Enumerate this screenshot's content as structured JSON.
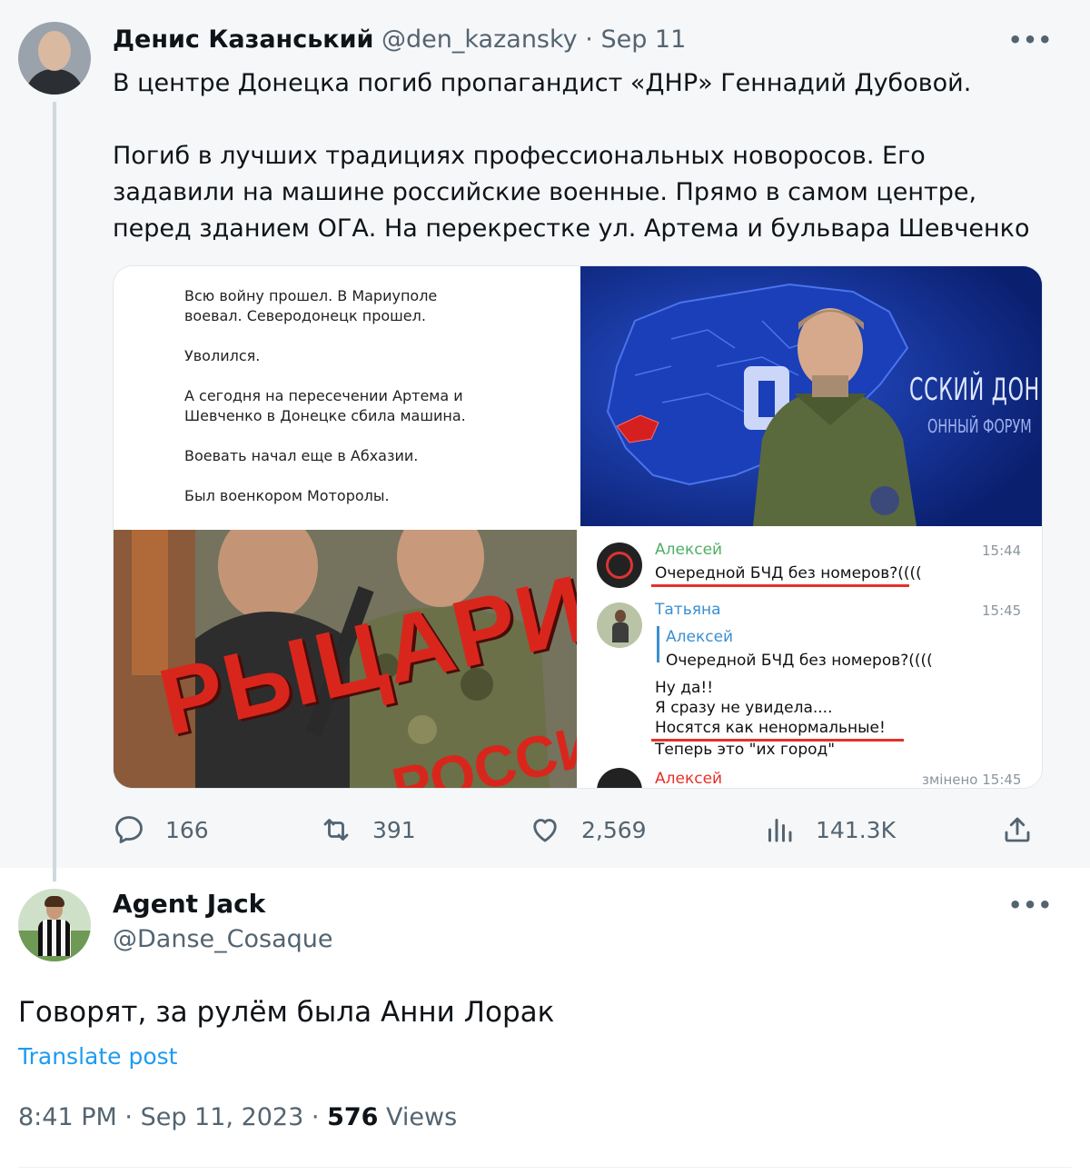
{
  "quoted_tweet": {
    "author_name": "Денис Казанський",
    "handle": "@den_kazansky",
    "separator": "·",
    "date": "Sep 11",
    "more_glyph": "•••",
    "text_p1": "В центре Донецка погиб пропагандист «ДНР» Геннадий Дубовой.",
    "text_p2": "Погиб в лучших традициях профессиональных новоросов. Его задавили на машине российские военные. Прямо в самом центре, перед зданием ОГА. На перекрестке ул. Артема и бульвара Шевченко",
    "media": {
      "text_panel": [
        "Всю войну прошел. В Мариуполе\nвоевал. Северодонецк прошел.",
        "Уволился.",
        "А сегодня на пересечении Артема и\nШевченко в Донецке сбила машина.",
        "Воевать начал еще в Абхазии.",
        "Был военкором Моторолы."
      ],
      "photo_brand_line1": "ССКИЙ ДОНБАСС",
      "photo_brand_line2": "ОННЫЙ ФОРУМ",
      "book_title": "РЫЦАРИ",
      "book_subtitle": "РОССИИ",
      "chat": {
        "m1_name": "Алексей",
        "m1_time": "15:44",
        "m1_text": "Очередной БЧД без номеров?((((",
        "m2_name": "Татьяна",
        "m2_time": "15:45",
        "m2_quote_name": "Алексей",
        "m2_quote_text": "Очередной БЧД без номеров?((((",
        "m2_line1": "Ну да!!",
        "m2_line2": "Я сразу не увидела....",
        "m2_line3": "Носятся как ненормальные!",
        "m2_line4": "Теперь это  \"их город\"",
        "m3_name": "Алексей",
        "m3_time": "змінено 15:45"
      }
    },
    "actions": {
      "replies": "166",
      "reposts": "391",
      "likes": "2,569",
      "views": "141.3K"
    }
  },
  "reply_tweet": {
    "author_name": "Agent Jack",
    "handle": "@Danse_Cosaque",
    "more_glyph": "•••",
    "text": "Говорят, за рулём была Анни Лорак",
    "translate_label": "Translate post",
    "time": "8:41 PM",
    "sep": "·",
    "date": "Sep 11, 2023",
    "views_count": "576",
    "views_label": "Views"
  },
  "colors": {
    "accent": "#1d9bf0",
    "secondary_text": "#536471",
    "chat_name_green": "#4fae65",
    "chat_name_blue": "#3a8fd1",
    "underline_red": "#e5302a"
  }
}
